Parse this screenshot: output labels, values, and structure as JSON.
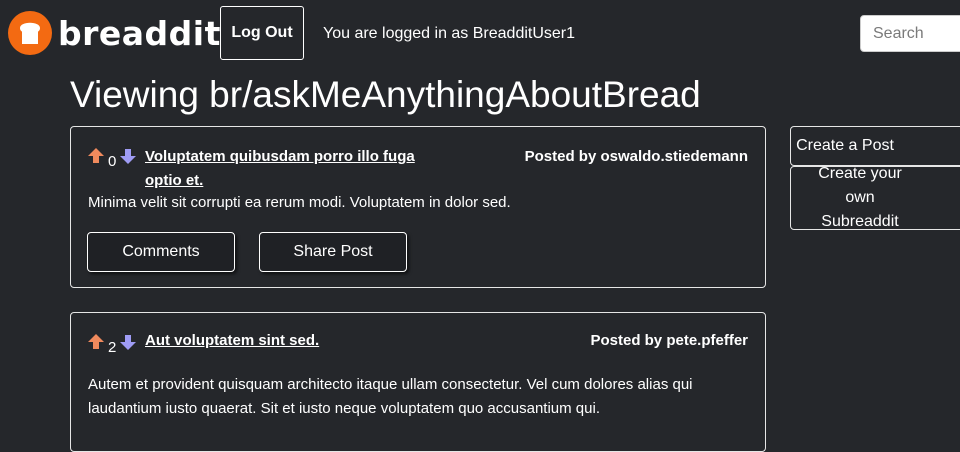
{
  "header": {
    "logo_text": "breaddit",
    "logout_label": "Log Out",
    "logged_in_text": "You are logged in as BreadditUser1",
    "search_placeholder": "Search"
  },
  "page_title": "Viewing br/askMeAnythingAboutBread",
  "sidebar": {
    "create_post_label": "Create a Post",
    "create_subreaddit_label": "Create your own Subreaddit"
  },
  "posts": [
    {
      "votes": "0",
      "title": "Voluptatem quibusdam porro illo fuga optio et.",
      "posted_by": "Posted by oswaldo.stiedemann",
      "body": "Minima velit sit corrupti ea rerum modi. Voluptatem in dolor sed.",
      "comments_label": "Comments",
      "share_label": "Share Post"
    },
    {
      "votes": "2",
      "title": "Aut voluptatem sint sed.",
      "posted_by": "Posted by pete.pfeffer",
      "body": "Autem et provident quisquam architecto itaque ullam consectetur. Vel cum dolores alias qui laudantium iusto quaerat. Sit et iusto neque voluptatem quo accusantium qui."
    }
  ],
  "colors": {
    "background": "#25272b",
    "logo_orange": "#f36a12",
    "upvote": "#f08a5d",
    "downvote": "#9f9cf5"
  },
  "icons": {
    "upvote": "arrow-up-icon",
    "downvote": "arrow-down-icon",
    "logo": "bread-logo-icon"
  }
}
